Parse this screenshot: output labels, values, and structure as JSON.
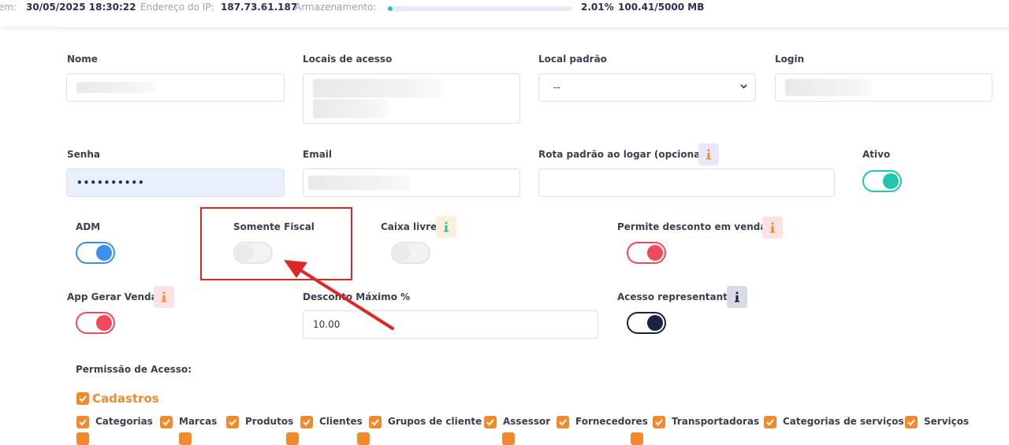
{
  "topbar": {
    "login_label": "em:",
    "login_value": "30/05/2025 18:30:22",
    "ip_label": "Endereço do IP:",
    "ip_value": "187.73.61.187",
    "storage_label": "Armazenamento:",
    "storage_fraction": 0.0201,
    "storage_percent": "2.01%",
    "storage_usage": "100.41/5000 MB"
  },
  "form": {
    "nome": {
      "label": "Nome"
    },
    "locais": {
      "label": "Locais de acesso"
    },
    "local_padrao": {
      "label": "Local padrão",
      "value": "--"
    },
    "login": {
      "label": "Login"
    },
    "senha": {
      "label": "Senha",
      "value": "••••••••••"
    },
    "email": {
      "label": "Email"
    },
    "rota": {
      "label": "Rota padrão ao logar (opcional)",
      "value": ""
    },
    "ativo": {
      "label": "Ativo",
      "checked": true
    },
    "adm": {
      "label": "ADM",
      "checked": true
    },
    "somente_fiscal": {
      "label": "Somente Fiscal",
      "checked": false
    },
    "caixa_livre": {
      "label": "Caixa livre",
      "checked": false
    },
    "permite_desconto": {
      "label": "Permite desconto em vendas",
      "checked": true
    },
    "app_gerar_venda": {
      "label": "App Gerar Venda",
      "checked": true
    },
    "desconto_maximo": {
      "label": "Desconto Máximo %",
      "value": "10.00"
    },
    "acesso_representante": {
      "label": "Acesso representante",
      "checked": true
    }
  },
  "colors": {
    "teal": "#20c6b0",
    "blue": "#3a8ff0",
    "red": "#f04a5c",
    "navy": "#1b2140",
    "orange": "#f08a2c",
    "annotation": "#e02525"
  },
  "permissions": {
    "title": "Permissão de Acesso:",
    "section": "Cadastros",
    "items": [
      "Categorias",
      "Marcas",
      "Produtos",
      "Clientes",
      "Grupos de cliente",
      "Assessor",
      "Fornecedores",
      "Transportadoras",
      "Categorias de serviços",
      "Serviços"
    ]
  }
}
